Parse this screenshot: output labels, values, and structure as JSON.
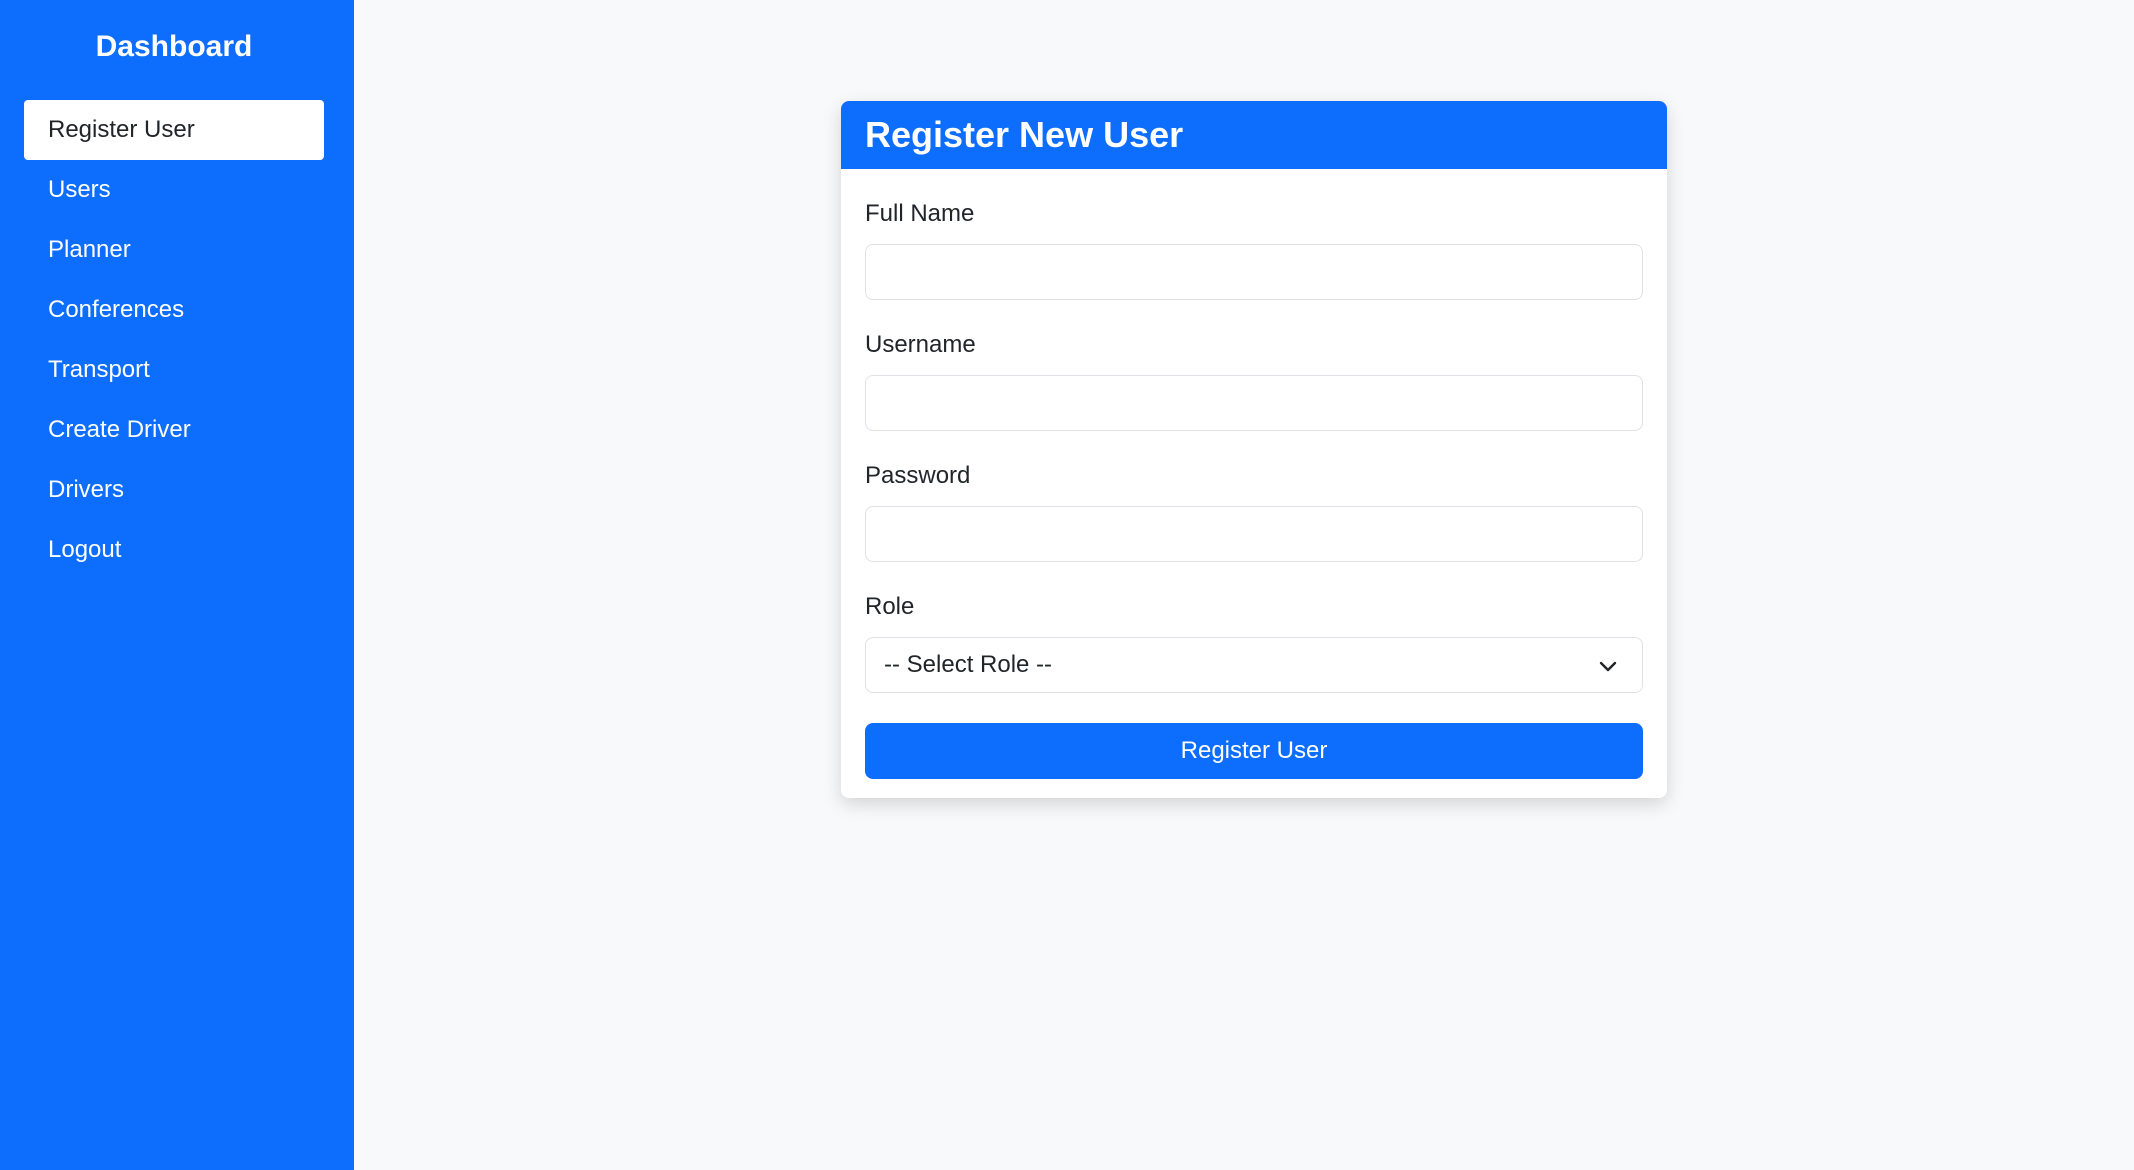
{
  "sidebar": {
    "title": "Dashboard",
    "items": [
      {
        "label": "Register User",
        "active": true
      },
      {
        "label": "Users"
      },
      {
        "label": "Planner"
      },
      {
        "label": "Conferences"
      },
      {
        "label": "Transport"
      },
      {
        "label": "Create Driver"
      },
      {
        "label": "Drivers"
      },
      {
        "label": "Logout"
      }
    ]
  },
  "form": {
    "title": "Register New User",
    "full_name": {
      "label": "Full Name",
      "value": ""
    },
    "username": {
      "label": "Username",
      "value": ""
    },
    "password": {
      "label": "Password",
      "value": ""
    },
    "role": {
      "label": "Role",
      "selected": "-- Select Role --"
    },
    "submit_label": "Register User"
  },
  "colors": {
    "primary": "#0d6efd",
    "background": "#f8f9fa",
    "card": "#ffffff",
    "text": "#212529"
  },
  "icons": {
    "role_dropdown": "chevron-down-icon"
  }
}
